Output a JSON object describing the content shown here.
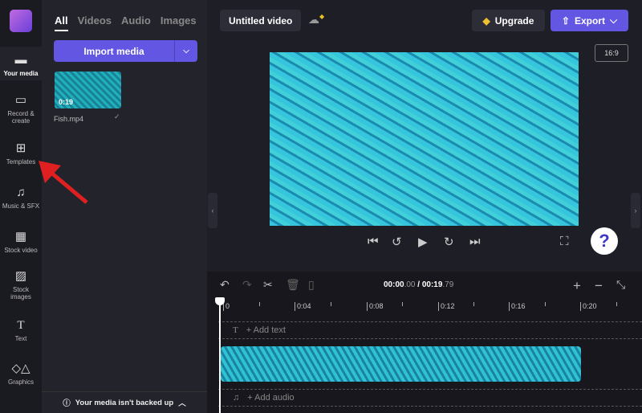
{
  "rail": {
    "items": [
      {
        "label": "Your media",
        "icon": "folder-icon"
      },
      {
        "label": "Record & create",
        "icon": "camera-icon"
      },
      {
        "label": "Templates",
        "icon": "templates-icon"
      },
      {
        "label": "Music & SFX",
        "icon": "music-icon"
      },
      {
        "label": "Stock video",
        "icon": "film-icon"
      },
      {
        "label": "Stock images",
        "icon": "image-icon"
      },
      {
        "label": "Text",
        "icon": "text-icon"
      },
      {
        "label": "Graphics",
        "icon": "shapes-icon"
      }
    ]
  },
  "panel": {
    "tabs": [
      "All",
      "Videos",
      "Audio",
      "Images"
    ],
    "import_label": "Import media",
    "media": [
      {
        "name": "Fish.mp4",
        "duration": "0:19"
      }
    ],
    "backup_text": "Your media isn't backed up"
  },
  "header": {
    "title": "Untitled video",
    "upgrade": "Upgrade",
    "export": "Export",
    "ratio": "16:9"
  },
  "timeline": {
    "current": "00:00",
    "current_ms": ".00",
    "total": "00:19",
    "total_ms": ".79",
    "ticks": [
      "0",
      "0:04",
      "0:08",
      "0:12",
      "0:16",
      "0:20"
    ],
    "add_text": "+ Add text",
    "add_audio": "+ Add audio"
  },
  "help": "?",
  "colors": {
    "accent": "#6256e3",
    "annotation": "#e02020"
  }
}
